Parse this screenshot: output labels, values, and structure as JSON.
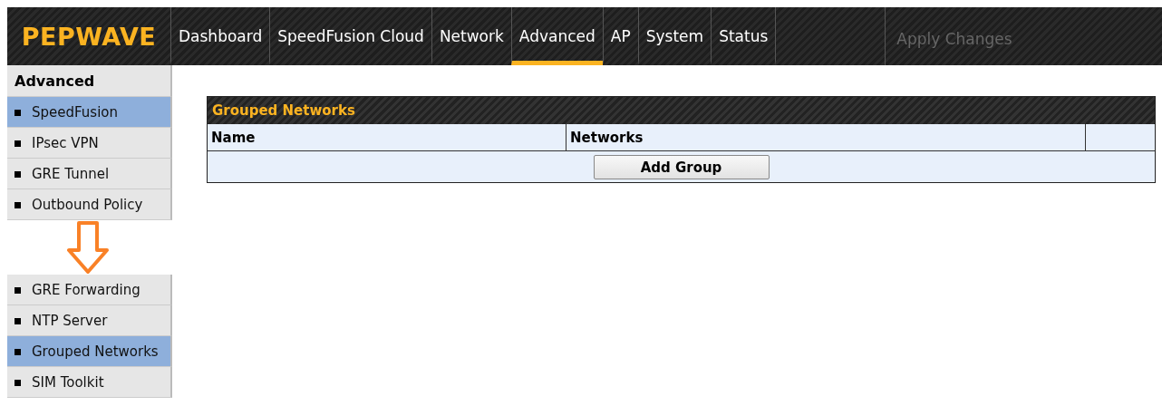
{
  "header": {
    "logo": "PEPWAVE",
    "tabs": [
      {
        "label": "Dashboard",
        "selected": false
      },
      {
        "label": "SpeedFusion Cloud",
        "selected": false
      },
      {
        "label": "Network",
        "selected": false
      },
      {
        "label": "Advanced",
        "selected": true
      },
      {
        "label": "AP",
        "selected": false
      },
      {
        "label": "System",
        "selected": false
      },
      {
        "label": "Status",
        "selected": false
      }
    ],
    "apply_button": {
      "label": "Apply Changes",
      "disabled": true
    }
  },
  "sidebar": {
    "title": "Advanced",
    "items": [
      {
        "label": "SpeedFusion",
        "selected": true
      },
      {
        "label": "IPsec VPN",
        "selected": false
      },
      {
        "label": "GRE Tunnel",
        "selected": false
      },
      {
        "label": "Outbound Policy",
        "selected": false
      },
      {
        "kind": "gap"
      },
      {
        "label": "GRE Forwarding",
        "selected": false
      },
      {
        "label": "NTP Server",
        "selected": false
      },
      {
        "label": "Grouped Networks",
        "selected": true
      },
      {
        "label": "SIM Toolkit",
        "selected": false
      }
    ]
  },
  "panel": {
    "title": "Grouped Networks",
    "columns": [
      "Name",
      "Networks"
    ],
    "button": "Add Group"
  }
}
